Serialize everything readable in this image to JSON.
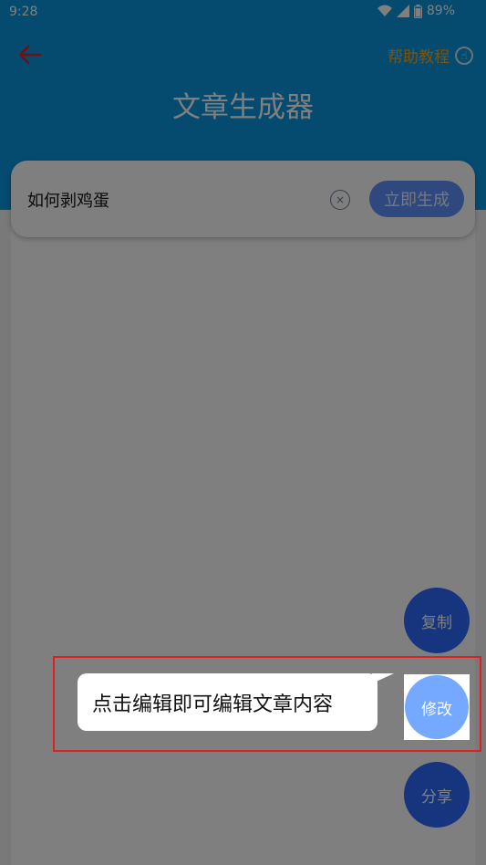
{
  "status_bar": {
    "time": "9:28",
    "battery": "89%"
  },
  "header": {
    "title": "文章生成器",
    "help_label": "帮助教程",
    "help_icon_glyph": "☝"
  },
  "search": {
    "value": "如何剥鸡蛋",
    "clear_glyph": "×",
    "generate_label": "立即生成"
  },
  "fabs": {
    "copy_label": "复制",
    "edit_label": "修改",
    "share_label": "分享"
  },
  "guide": {
    "tooltip": "点击编辑即可编辑文章内容"
  },
  "colors": {
    "header": "#0a96df",
    "accent_orange": "#f5a623",
    "fab": "#2f6bff",
    "highlight_border": "#e02020"
  }
}
